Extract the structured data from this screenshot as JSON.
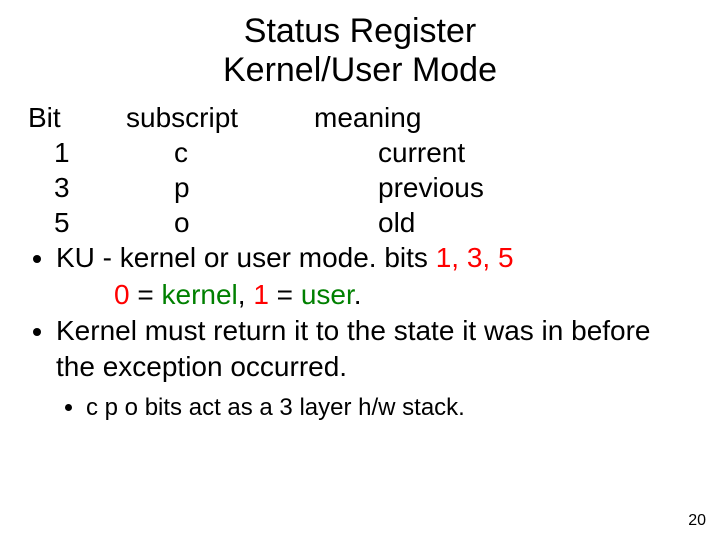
{
  "title_line1": "Status Register",
  "title_line2": "Kernel/User Mode",
  "table": {
    "headers": {
      "bit": "Bit",
      "subscript": "subscript",
      "meaning": "meaning"
    },
    "rows": [
      {
        "bit": "1",
        "subscript": "c",
        "meaning": "current"
      },
      {
        "bit": "3",
        "subscript": "p",
        "meaning": "previous"
      },
      {
        "bit": "5",
        "subscript": "o",
        "meaning": "old"
      }
    ]
  },
  "bullets": {
    "b1_prefix": "KU - kernel or user mode. bits ",
    "b1_bits1": "1",
    "b1_comma1": ",",
    "b1_bits2": "3",
    "b1_comma2": ",",
    "b1_bits3": "5",
    "b1_line2_zero": "0",
    "b1_line2_eq1": " = ",
    "b1_line2_kernel": "kernel",
    "b1_line2_comma": ", ",
    "b1_line2_one": "1",
    "b1_line2_eq2": " = ",
    "b1_line2_user": "user",
    "b1_line2_period": ".",
    "b2": "Kernel must return it to the state it was in before the exception occurred.",
    "sub1": "c p o  bits act as a 3 layer h/w stack."
  },
  "page_number": "20"
}
